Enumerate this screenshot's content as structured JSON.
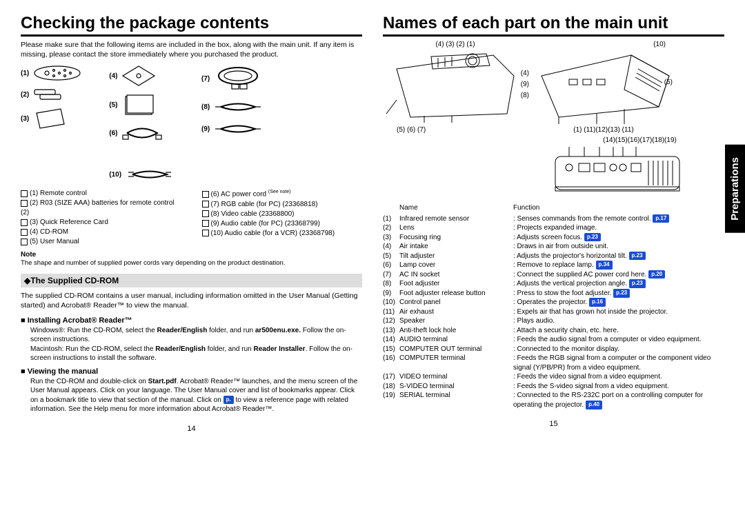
{
  "left": {
    "title": "Checking the package contents",
    "intro": "Please make sure that the following items are included in the box, along with the main unit. If any item is missing, please contact the store immediately where you purchased the product.",
    "list_a": {
      "i1": "(1)  Remote control",
      "i2": "(2)  R03 (SIZE AAA) batteries for remote control (2)",
      "i3": "(3)  Quick Reference Card",
      "i4": "(4)  CD-ROM",
      "i5": "(5)  User Manual"
    },
    "list_b": {
      "i6": "(6)  AC power cord ",
      "i6_sup": "(See note)",
      "i7": "(7)  RGB cable (for PC) (23368818)",
      "i8": "(8)  Video cable (23368800)",
      "i9": "(9)  Audio cable (for PC) (23368799)",
      "i10": "(10) Audio cable (for a VCR) (23368798)"
    },
    "note_h": "Note",
    "note_t": "The shape and number of supplied power cords vary depending on the product destination.",
    "cd_h": "The Supplied CD-ROM",
    "cd_t": "The supplied CD-ROM contains a user manual, including information omitted in the User Manual (Getting started) and Acrobat® Reader™ to view the manual.",
    "install_h": "Installing Acrobat® Reader™",
    "install_t1": "Windows®: Run the CD-ROM, select the ",
    "install_b1": "Reader/English",
    "install_t2": " folder, and run ",
    "install_b2": "ar500enu.exe.",
    "install_t3": " Follow the on-screen instructions.",
    "install_t4": "Macintosh: Run the CD-ROM, select the ",
    "install_b3": "Reader/English",
    "install_t5": " folder, and run ",
    "install_b4": "Reader Installer",
    "install_t6": ". Follow the on-screen instructions to install the software.",
    "view_h": "Viewing the manual",
    "view_t1": "Run the CD-ROM and double-click on ",
    "view_b1": "Start.pdf",
    "view_t2": ". Acrobat® Reader™ launches, and the menu screen of the User Manual appears. Click on your language. The User Manual cover and list of bookmarks appear. Click on a bookmark title to view that section of the manual. Click on ",
    "view_ref": "p.",
    "view_t3": " to view a reference page with related information. See the Help menu for more information about Acrobat® Reader™.",
    "pagenum": "14"
  },
  "right": {
    "title": "Names of each part on the main unit",
    "side_tab": "Preparations",
    "th_name": "Name",
    "th_func": "Function",
    "callouts": {
      "d1": "(4)   (3)   (2) (1)",
      "d1r": "(4)\n(9)\n(8)",
      "d1b": "(5)  (6)      (7)",
      "d2t": "(10)",
      "d2r": "(5)",
      "d2b": "(1) (11)(12)(13) (11)",
      "d3t": "(14)(15)(16)(17)(18)(19)"
    },
    "parts": [
      {
        "n": "(1)",
        "name": "Infrared remote sensor",
        "sep": ":",
        "func": "Senses commands from the remote control.",
        "p": "p.17"
      },
      {
        "n": "(2)",
        "name": "Lens",
        "sep": ":",
        "func": "Projects expanded image."
      },
      {
        "n": "(3)",
        "name": "Focusing ring",
        "sep": ":",
        "func": "Adjusts screen focus.",
        "p": "p.23"
      },
      {
        "n": "(4)",
        "name": "Air intake",
        "sep": ":",
        "func": "Draws in air from outside unit."
      },
      {
        "n": "(5)",
        "name": "Tilt adjuster",
        "sep": ":",
        "func": "Adjusts the projector's horizontal tilt.",
        "p": "p.23"
      },
      {
        "n": "(6)",
        "name": "Lamp cover",
        "sep": ":",
        "func": "Remove to replace lamp.",
        "p": "p.34"
      },
      {
        "n": "(7)",
        "name": "AC IN socket",
        "sep": ":",
        "func": "Connect the supplied AC power cord here.",
        "p": "p.20"
      },
      {
        "n": "(8)",
        "name": "Foot adjuster",
        "sep": ":",
        "func": "Adjusts the vertical projection angle.",
        "p": "p.23"
      },
      {
        "n": "(9)",
        "name": "Foot adjuster release button",
        "sep": ":",
        "func": "Press to stow the foot adjuster.",
        "p": "p.23"
      },
      {
        "n": "(10)",
        "name": "Control panel",
        "sep": ":",
        "func": "Operates the projector.",
        "p": "p.16"
      },
      {
        "n": "(11)",
        "name": "Air exhaust",
        "sep": ":",
        "func": "Expels air that has grown hot inside the projector."
      },
      {
        "n": "(12)",
        "name": "Speaker",
        "sep": ":",
        "func": "Plays audio."
      },
      {
        "n": "(13)",
        "name": "Anti-theft lock hole",
        "sep": ":",
        "func": "Attach a security chain, etc. here."
      },
      {
        "n": "(14)",
        "name": "AUDIO terminal",
        "sep": ":",
        "func": "Feeds the audio signal from a computer or video equipment."
      },
      {
        "n": "(15)",
        "name": "COMPUTER OUT terminal",
        "sep": ":",
        "func": "Connected to the monitor display."
      },
      {
        "n": "(16)",
        "name": "COMPUTER terminal",
        "sep": ":",
        "func": "Feeds the RGB signal from a computer or the component video signal (Y/PB/PR) from a video equipment."
      },
      {
        "n": "(17)",
        "name": "VIDEO terminal",
        "sep": ":",
        "func": "Feeds the video signal from a video equipment."
      },
      {
        "n": "(18)",
        "name": "S-VIDEO terminal",
        "sep": ":",
        "func": "Feeds the S-video signal from a video equipment."
      },
      {
        "n": "(19)",
        "name": "SERIAL terminal",
        "sep": ":",
        "func": "Connected to the RS-232C port on a controlling computer for operating the projector.",
        "p": "p.40"
      }
    ],
    "pagenum": "15"
  }
}
